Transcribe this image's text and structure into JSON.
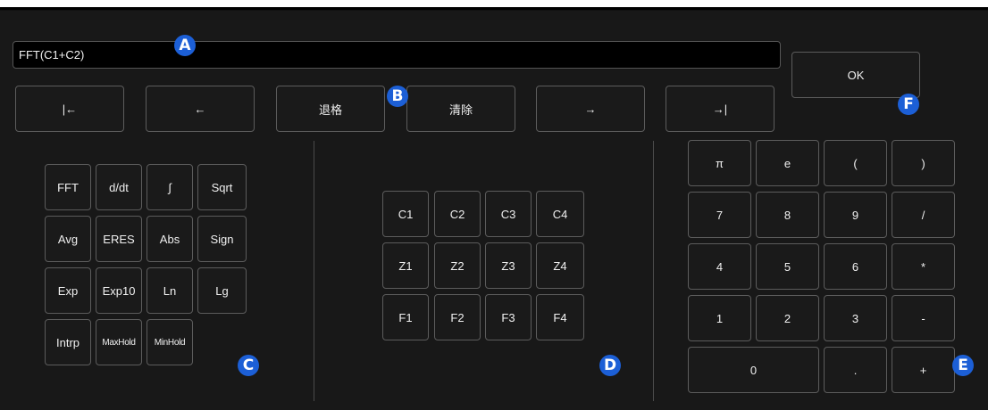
{
  "expression": {
    "value": "FFT(C1+C2)"
  },
  "edit_row": {
    "home": "|←",
    "left": "←",
    "backspace": "退格",
    "clear": "清除",
    "right": "→",
    "end": "→|"
  },
  "ok_label": "OK",
  "functions": [
    [
      "FFT",
      "d/dt",
      "∫",
      "Sqrt"
    ],
    [
      "Avg",
      "ERES",
      "Abs",
      "Sign"
    ],
    [
      "Exp",
      "Exp10",
      "Ln",
      "Lg"
    ],
    [
      "Intrp",
      "MaxHold",
      "MinHold"
    ]
  ],
  "sources": [
    [
      "C1",
      "C2",
      "C3",
      "C4"
    ],
    [
      "Z1",
      "Z2",
      "Z3",
      "Z4"
    ],
    [
      "F1",
      "F2",
      "F3",
      "F4"
    ]
  ],
  "keypad": [
    [
      "π",
      "e",
      "(",
      ")"
    ],
    [
      "7",
      "8",
      "9",
      "/"
    ],
    [
      "4",
      "5",
      "6",
      "*"
    ],
    [
      "1",
      "2",
      "3",
      "-"
    ],
    [
      "0",
      ".",
      "+"
    ]
  ],
  "markers": {
    "a": "A",
    "b": "B",
    "c": "C",
    "d": "D",
    "e": "E",
    "f": "F"
  },
  "colors": {
    "background": "#181818",
    "marker": "#1c5fd6",
    "border": "#5c5c5c"
  }
}
